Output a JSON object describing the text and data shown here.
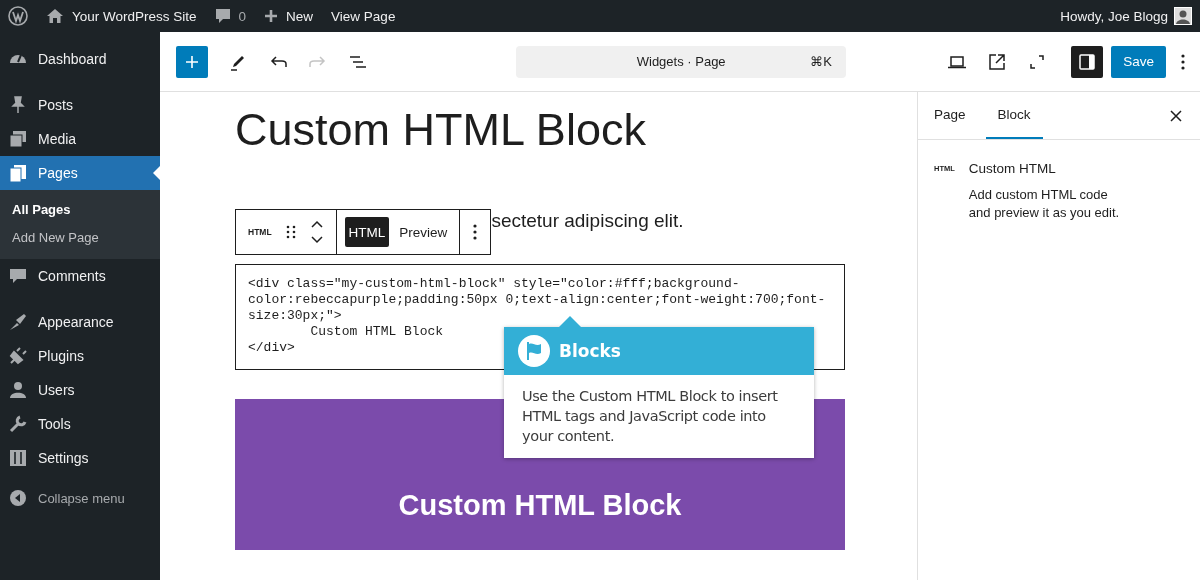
{
  "admin_bar": {
    "site_name": "Your WordPress Site",
    "comments_count": "0",
    "new_label": "New",
    "view_label": "View Page",
    "greeting": "Howdy, Joe Blogg"
  },
  "menu_groups": [
    [
      {
        "label": "Dashboard",
        "selected": false
      }
    ],
    [
      {
        "label": "Posts",
        "selected": false
      },
      {
        "label": "Media",
        "selected": false
      },
      {
        "label": "Pages",
        "selected": true,
        "children": [
          {
            "label": "All Pages",
            "selected": true
          },
          {
            "label": "Add New Page",
            "selected": false
          }
        ]
      },
      {
        "label": "Comments",
        "selected": false
      }
    ],
    [
      {
        "label": "Appearance",
        "selected": false
      },
      {
        "label": "Plugins",
        "selected": false
      },
      {
        "label": "Users",
        "selected": false
      },
      {
        "label": "Tools",
        "selected": false
      },
      {
        "label": "Settings",
        "selected": false
      }
    ]
  ],
  "collapse_label": "Collapse menu",
  "toolbar": {
    "redo_disabled": true,
    "command_title": "Widgets · Page",
    "command_shortcut": "⌘K",
    "settings_open": true,
    "save_label": "Save"
  },
  "editor": {
    "title": "Custom HTML Block",
    "paragraph": "sectetur adipiscing elit.",
    "block_toolbar": {
      "type_label": "HTML",
      "modes": [
        {
          "label": "HTML",
          "selected": true
        },
        {
          "label": "Preview",
          "selected": false
        }
      ]
    },
    "code": "<div class=\"my-custom-html-block\" style=\"color:#fff;background-color:rebeccapurple;padding:50px 0;text-align:center;font-weight:700;font-size:30px;\">\n        Custom HTML Block\n</div>",
    "preview_text": "Custom HTML Block"
  },
  "sidebar": {
    "tabs": [
      {
        "label": "Page",
        "selected": false
      },
      {
        "label": "Block",
        "selected": true
      }
    ],
    "block_icon_label": "HTML",
    "block_name": "Custom HTML",
    "block_description": "Add custom HTML code and preview it as you edit."
  },
  "tooltip": {
    "title": "Blocks",
    "body": "Use the Custom HTML Block to insert HTML tags and JavaScript code into your content."
  }
}
